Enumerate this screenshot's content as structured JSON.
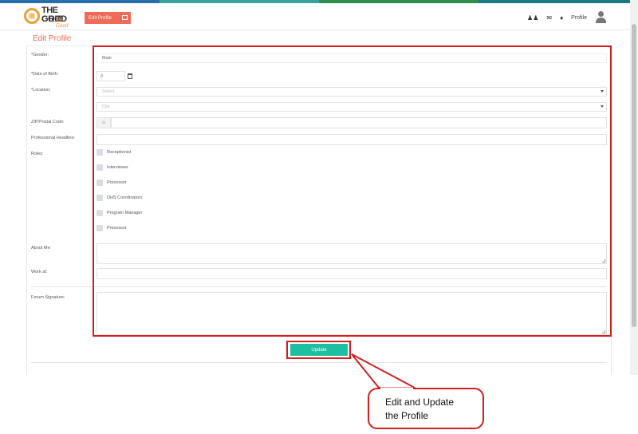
{
  "colors": {
    "accent": "#ef6b57",
    "annotation": "#d01f1f",
    "update_button": "#1dbfa2",
    "topstrip": [
      "#2a6ea8",
      "#3ca29c",
      "#2f8f4e",
      "#1b7a82"
    ]
  },
  "header": {
    "logo_line1": "THE GOOD",
    "logo_line2": "GRID",
    "logo_tagline": "for Good",
    "edit_profile_label": "Edit Profile",
    "edit_profile_icon": "id-card-icon",
    "profile_label": "Profile",
    "icons": [
      "users-icon",
      "envelope-icon",
      "bell-icon",
      "user-avatar-icon"
    ]
  },
  "page": {
    "title": "Edit Profile"
  },
  "form": {
    "gender": {
      "label": "*Gender:",
      "value": "Male"
    },
    "dob": {
      "label": "*Date of Birth:",
      "value": "//"
    },
    "location": {
      "label": "*Location:",
      "country_placeholder": "Select",
      "city_placeholder": "City"
    },
    "zip": {
      "label": "ZIP/Postal Code:",
      "icon": "home-icon"
    },
    "headline": {
      "label": "Professional Headline:"
    },
    "roles": {
      "label": "Roles:",
      "items": [
        "Receptionist",
        "Interviewer",
        "Processor",
        "DHS Coordinators",
        "Program Manager",
        "Processor"
      ]
    },
    "about": {
      "label": "About Me:"
    },
    "work": {
      "label": "Work at:"
    },
    "signature": {
      "label": "Forum Signature:"
    },
    "update_label": "Update"
  },
  "callout": {
    "line1": "Edit and Update",
    "line2": "the Profile"
  }
}
